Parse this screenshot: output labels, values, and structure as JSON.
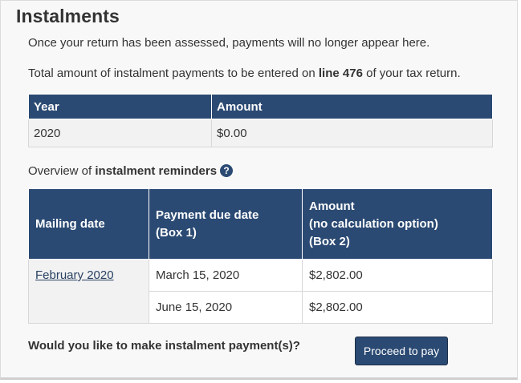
{
  "section": {
    "title": "Instalments",
    "assessed_note": "Once your return has been assessed, payments will no longer appear here.",
    "total_note_before": "Total amount of instalment payments to be entered on ",
    "total_note_bold": "line 476",
    "total_note_after": " of your tax return."
  },
  "year_table": {
    "headers": [
      "Year",
      "Amount"
    ],
    "rows": [
      {
        "year": "2020",
        "amount": "$0.00"
      }
    ]
  },
  "reminders": {
    "overview_before": "Overview of ",
    "overview_bold": "instalment reminders",
    "help_icon": "question-circle-icon",
    "help_glyph": "?",
    "headers": {
      "mailing_date": "Mailing date",
      "due_date_line1": "Payment due date",
      "due_date_line2": "(Box 1)",
      "amount_line1": "Amount",
      "amount_line2": "(no calculation option)",
      "amount_line3": "(Box 2)"
    },
    "mailing_link": "February 2020",
    "rows": [
      {
        "due_date": "March 15, 2020",
        "amount": "$2,802.00"
      },
      {
        "due_date": "June 15, 2020",
        "amount": "$2,802.00"
      }
    ]
  },
  "payment": {
    "question": "Would you like to make instalment payment(s)?",
    "button_label": "Proceed to pay"
  },
  "colors": {
    "header_bg": "#2b4a73",
    "link": "#284162",
    "panel_bg": "#f8f8f8"
  }
}
